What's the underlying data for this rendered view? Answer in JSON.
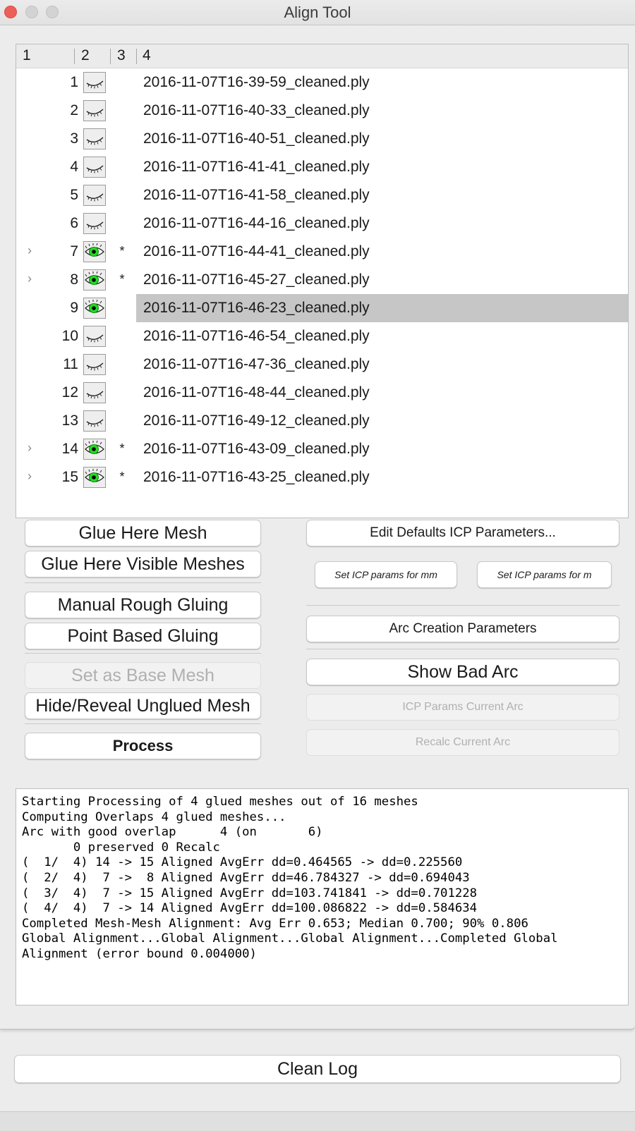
{
  "window": {
    "title": "Align Tool"
  },
  "tree": {
    "headers": [
      "1",
      "2",
      "3",
      "4"
    ],
    "rows": [
      {
        "num": "1",
        "visible": false,
        "star": "",
        "expand": false,
        "file": "2016-11-07T16-39-59_cleaned.ply",
        "selected": false
      },
      {
        "num": "2",
        "visible": false,
        "star": "",
        "expand": false,
        "file": "2016-11-07T16-40-33_cleaned.ply",
        "selected": false
      },
      {
        "num": "3",
        "visible": false,
        "star": "",
        "expand": false,
        "file": "2016-11-07T16-40-51_cleaned.ply",
        "selected": false
      },
      {
        "num": "4",
        "visible": false,
        "star": "",
        "expand": false,
        "file": "2016-11-07T16-41-41_cleaned.ply",
        "selected": false
      },
      {
        "num": "5",
        "visible": false,
        "star": "",
        "expand": false,
        "file": "2016-11-07T16-41-58_cleaned.ply",
        "selected": false
      },
      {
        "num": "6",
        "visible": false,
        "star": "",
        "expand": false,
        "file": "2016-11-07T16-44-16_cleaned.ply",
        "selected": false
      },
      {
        "num": "7",
        "visible": true,
        "star": "*",
        "expand": true,
        "file": "2016-11-07T16-44-41_cleaned.ply",
        "selected": false
      },
      {
        "num": "8",
        "visible": true,
        "star": "*",
        "expand": true,
        "file": "2016-11-07T16-45-27_cleaned.ply",
        "selected": false
      },
      {
        "num": "9",
        "visible": true,
        "star": "",
        "expand": false,
        "file": "2016-11-07T16-46-23_cleaned.ply",
        "selected": true
      },
      {
        "num": "10",
        "visible": false,
        "star": "",
        "expand": false,
        "file": "2016-11-07T16-46-54_cleaned.ply",
        "selected": false
      },
      {
        "num": "11",
        "visible": false,
        "star": "",
        "expand": false,
        "file": "2016-11-07T16-47-36_cleaned.ply",
        "selected": false
      },
      {
        "num": "12",
        "visible": false,
        "star": "",
        "expand": false,
        "file": "2016-11-07T16-48-44_cleaned.ply",
        "selected": false
      },
      {
        "num": "13",
        "visible": false,
        "star": "",
        "expand": false,
        "file": "2016-11-07T16-49-12_cleaned.ply",
        "selected": false
      },
      {
        "num": "14",
        "visible": true,
        "star": "*",
        "expand": true,
        "file": "2016-11-07T16-43-09_cleaned.ply",
        "selected": false
      },
      {
        "num": "15",
        "visible": true,
        "star": "*",
        "expand": true,
        "file": "2016-11-07T16-43-25_cleaned.ply",
        "selected": false
      }
    ]
  },
  "left_buttons": {
    "glue_here_mesh": "Glue Here Mesh",
    "glue_visible": "Glue Here Visible Meshes",
    "manual_rough": "Manual Rough Gluing",
    "point_based": "Point Based Gluing",
    "set_base": "Set as Base Mesh",
    "hide_reveal": "Hide/Reveal Unglued Mesh",
    "process": "Process"
  },
  "right_buttons": {
    "edit_defaults": "Edit Defaults ICP Parameters...",
    "icp_mm": "Set ICP params for mm",
    "icp_m": "Set ICP params for m",
    "arc_creation": "Arc Creation Parameters",
    "show_bad_arc": "Show Bad Arc",
    "icp_current_arc": "ICP Params Current Arc",
    "recalc_arc": "Recalc Current Arc"
  },
  "log": {
    "lines": [
      "Starting Processing of 4 glued meshes out of 16 meshes",
      "Computing Overlaps 4 glued meshes...",
      "Arc with good overlap      4 (on       6)",
      "       0 preserved 0 Recalc",
      "(  1/  4) 14 -> 15 Aligned AvgErr dd=0.464565 -> dd=0.225560",
      "(  2/  4)  7 ->  8 Aligned AvgErr dd=46.784327 -> dd=0.694043",
      "(  3/  4)  7 -> 15 Aligned AvgErr dd=103.741841 -> dd=0.701228",
      "(  4/  4)  7 -> 14 Aligned AvgErr dd=100.086822 -> dd=0.584634",
      "Completed Mesh-Mesh Alignment: Avg Err 0.653; Median 0.700; 90% 0.806",
      "Global Alignment...Global Alignment...Global Alignment...Completed Global",
      "Alignment (error bound 0.004000)"
    ]
  },
  "clean_log": "Clean Log",
  "icons": {
    "visible": "eye-open-icon",
    "hidden": "eye-closed-icon",
    "expand": "chevron-right-icon"
  },
  "colors": {
    "eye_green": "#22dd22",
    "close": "#ee5f57",
    "selection": "#c6c6c6"
  }
}
